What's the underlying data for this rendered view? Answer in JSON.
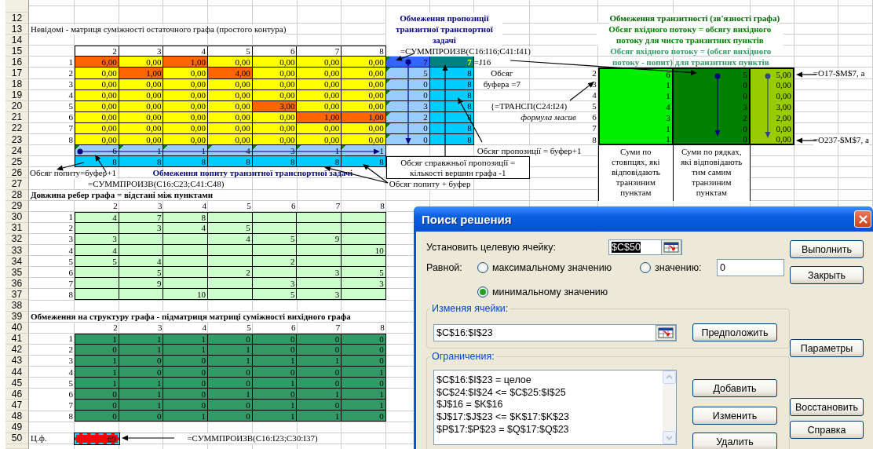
{
  "row_headers": [
    "12",
    "13",
    "14",
    "15",
    "16",
    "17",
    "18",
    "19",
    "20",
    "21",
    "22",
    "23",
    "24",
    "25",
    "26",
    "27",
    "28",
    "29",
    "30",
    "31",
    "32",
    "33",
    "34",
    "35",
    "36",
    "37",
    "38",
    "39",
    "40",
    "41",
    "42",
    "43",
    "44",
    "45",
    "46",
    "47",
    "48",
    "49",
    "50"
  ],
  "unknowns": {
    "title": "Невідомі - матриця суміжності остаточного графа (простого контура)",
    "column_headers": [
      "2",
      "3",
      "4",
      "5",
      "6",
      "7",
      "8"
    ],
    "rows": [
      {
        "label": "1",
        "cells": [
          {
            "value": "6,00",
            "highlighted": true
          },
          {
            "value": "0,00",
            "highlighted": false
          },
          {
            "value": "1,00",
            "highlighted": true
          },
          {
            "value": "0,00",
            "highlighted": false
          },
          {
            "value": "0,00",
            "highlighted": false
          },
          {
            "value": "0,00",
            "highlighted": false
          },
          {
            "value": "0,00",
            "highlighted": false
          }
        ]
      },
      {
        "label": "2",
        "cells": [
          {
            "value": "0,00",
            "highlighted": false
          },
          {
            "value": "1,00",
            "highlighted": true
          },
          {
            "value": "0,00",
            "highlighted": false
          },
          {
            "value": "4,00",
            "highlighted": true
          },
          {
            "value": "0,00",
            "highlighted": false
          },
          {
            "value": "0,00",
            "highlighted": false
          },
          {
            "value": "0,00",
            "highlighted": false
          }
        ]
      },
      {
        "label": "3",
        "cells": [
          {
            "value": "0,00",
            "highlighted": false
          },
          {
            "value": "0,00",
            "highlighted": false
          },
          {
            "value": "0,00",
            "highlighted": false
          },
          {
            "value": "0,00",
            "highlighted": false
          },
          {
            "value": "0,00",
            "highlighted": false
          },
          {
            "value": "0,00",
            "highlighted": false
          },
          {
            "value": "0,00",
            "highlighted": false
          }
        ]
      },
      {
        "label": "4",
        "cells": [
          {
            "value": "0,00",
            "highlighted": false
          },
          {
            "value": "0,00",
            "highlighted": false
          },
          {
            "value": "0,00",
            "highlighted": false
          },
          {
            "value": "0,00",
            "highlighted": false
          },
          {
            "value": "0,00",
            "highlighted": false
          },
          {
            "value": "0,00",
            "highlighted": false
          },
          {
            "value": "0,00",
            "highlighted": false
          }
        ]
      },
      {
        "label": "5",
        "cells": [
          {
            "value": "0,00",
            "highlighted": false
          },
          {
            "value": "0,00",
            "highlighted": false
          },
          {
            "value": "0,00",
            "highlighted": false
          },
          {
            "value": "0,00",
            "highlighted": false
          },
          {
            "value": "3,00",
            "highlighted": true
          },
          {
            "value": "0,00",
            "highlighted": false
          },
          {
            "value": "0,00",
            "highlighted": false
          }
        ]
      },
      {
        "label": "6",
        "cells": [
          {
            "value": "0,00",
            "highlighted": false
          },
          {
            "value": "0,00",
            "highlighted": false
          },
          {
            "value": "0,00",
            "highlighted": false
          },
          {
            "value": "0,00",
            "highlighted": false
          },
          {
            "value": "0,00",
            "highlighted": false
          },
          {
            "value": "1,00",
            "highlighted": true
          },
          {
            "value": "1,00",
            "highlighted": true
          }
        ]
      },
      {
        "label": "7",
        "cells": [
          {
            "value": "0,00",
            "highlighted": false
          },
          {
            "value": "0,00",
            "highlighted": false
          },
          {
            "value": "0,00",
            "highlighted": false
          },
          {
            "value": "0,00",
            "highlighted": false
          },
          {
            "value": "0,00",
            "highlighted": false
          },
          {
            "value": "0,00",
            "highlighted": false
          },
          {
            "value": "0,00",
            "highlighted": false
          }
        ]
      },
      {
        "label": "8",
        "cells": [
          {
            "value": "0,00",
            "highlighted": false
          },
          {
            "value": "0,00",
            "highlighted": false
          },
          {
            "value": "0,00",
            "highlighted": false
          },
          {
            "value": "0,00",
            "highlighted": false
          },
          {
            "value": "0,00",
            "highlighted": false
          },
          {
            "value": "0,00",
            "highlighted": false
          },
          {
            "value": "0,00",
            "highlighted": false
          }
        ]
      }
    ],
    "demand": [
      "6",
      "1",
      "1",
      "4",
      "3",
      "1",
      "1"
    ],
    "demand_limit": [
      "8",
      "8",
      "8",
      "8",
      "8",
      "8",
      "8"
    ]
  },
  "supply": {
    "title": "Обмеження пропозиції транзитної транспортної задачі",
    "formula": "=СУММПРОИЗВ(C16:I16;C41:I41)",
    "rows": [
      {
        "kind": "source",
        "used": "7",
        "limit": "7"
      },
      {
        "kind": "transit",
        "used": "5",
        "limit": "8"
      },
      {
        "kind": "transit",
        "used": "0",
        "limit": "8"
      },
      {
        "kind": "transit",
        "used": "0",
        "limit": "8"
      },
      {
        "kind": "transit",
        "used": "3",
        "limit": "8"
      },
      {
        "kind": "transit",
        "used": "2",
        "limit": "8"
      },
      {
        "kind": "transit",
        "used": "0",
        "limit": "8"
      },
      {
        "kind": "transit",
        "used": "0",
        "limit": "8"
      }
    ],
    "buffer_label": "Обсяг",
    "buffer_value": "буфера =7",
    "transpose_formula": "{=ТРАНСП(C24:I24)",
    "array_note": "формула масив",
    "supply_note": "Обсяг пропозиції = буфер+1",
    "real_supply_note": "Обсяг справжньої пропозиції = кількості вершин графа -1"
  },
  "demand_notes": {
    "demand_note": "Обсяг попиту=буфер+1",
    "title": "Обмеження попиту транзитної транспортної задачі",
    "formula": "=СУММПРОИЗВ(C16:C23;C41:C48)",
    "buffer_note": "Обсяг попиту + буфер"
  },
  "distances": {
    "title": "Довжина ребер графа = відстані між пунктами",
    "column_headers": [
      "2",
      "3",
      "4",
      "5",
      "6",
      "7",
      "8"
    ],
    "rows": [
      {
        "label": "1",
        "cells": [
          "4",
          "7",
          "8",
          null,
          null,
          null,
          null
        ]
      },
      {
        "label": "2",
        "cells": [
          null,
          "3",
          "4",
          "5",
          null,
          null,
          null
        ]
      },
      {
        "label": "3",
        "cells": [
          "3",
          null,
          null,
          "4",
          "5",
          "9",
          null
        ]
      },
      {
        "label": "4",
        "cells": [
          "4",
          null,
          null,
          null,
          null,
          null,
          "10"
        ]
      },
      {
        "label": "5",
        "cells": [
          "5",
          "4",
          null,
          null,
          "2",
          null,
          null
        ]
      },
      {
        "label": "6",
        "cells": [
          null,
          "5",
          null,
          "2",
          null,
          "3",
          "5"
        ]
      },
      {
        "label": "7",
        "cells": [
          null,
          "9",
          null,
          null,
          "3",
          null,
          "3"
        ]
      },
      {
        "label": "8",
        "cells": [
          null,
          null,
          "10",
          null,
          "5",
          "3",
          null
        ]
      }
    ]
  },
  "structure": {
    "title": "Обмеження на структуру графа - підматриця матриці суміжності вихідного графа",
    "column_headers": [
      "2",
      "3",
      "4",
      "5",
      "6",
      "7",
      "8"
    ],
    "rows": [
      {
        "label": "1",
        "cells": [
          "1",
          "1",
          "1",
          "0",
          "0",
          "0",
          "0"
        ]
      },
      {
        "label": "2",
        "cells": [
          "0",
          "1",
          "1",
          "1",
          "0",
          "0",
          "0"
        ]
      },
      {
        "label": "3",
        "cells": [
          "1",
          "0",
          "0",
          "1",
          "1",
          "1",
          "0"
        ]
      },
      {
        "label": "4",
        "cells": [
          "1",
          "0",
          "0",
          "0",
          "0",
          "0",
          "1"
        ]
      },
      {
        "label": "5",
        "cells": [
          "1",
          "1",
          "0",
          "0",
          "1",
          "0",
          "0"
        ]
      },
      {
        "label": "6",
        "cells": [
          "0",
          "1",
          "0",
          "1",
          "0",
          "1",
          "1"
        ]
      },
      {
        "label": "7",
        "cells": [
          "0",
          "1",
          "0",
          "0",
          "1",
          "0",
          "1"
        ]
      },
      {
        "label": "8",
        "cells": [
          "0",
          "0",
          "1",
          "0",
          "1",
          "1",
          "0"
        ]
      }
    ]
  },
  "transit": {
    "title": "Обмеження транзитності (зв'язності графа)",
    "rule_1": "Обсяг вхідного потоку = обсягу вихідного потоку для чисто транзитних пунктів",
    "rule_2": "Обсяг вхідного потоку = (обсяг вихідного потоку - попит) для транзитних пунктів",
    "ref_formula": "=J16",
    "rows": [
      {
        "label": "2",
        "column_sum": "6",
        "row_sum": "5",
        "balance": "5,00"
      },
      {
        "label": "3",
        "column_sum": "1",
        "row_sum": "0",
        "balance": "0,00"
      },
      {
        "label": "4",
        "column_sum": "1",
        "row_sum": "0",
        "balance": "0,00"
      },
      {
        "label": "5",
        "column_sum": "4",
        "row_sum": "3",
        "balance": "3,00"
      },
      {
        "label": "6",
        "column_sum": "3",
        "row_sum": "2",
        "balance": "2,00"
      },
      {
        "label": "7",
        "column_sum": "1",
        "row_sum": "0",
        "balance": "0,00"
      },
      {
        "label": "8",
        "column_sum": "1",
        "row_sum": "0",
        "balance": "0,00"
      }
    ],
    "first_formula": "=O17-$M$7, а",
    "last_formula": "=O237-$M$7, а",
    "column_sum_note": "Суми по стовпцях, які відповідають транзиним пунктам",
    "row_sum_note": "Суми по рядках, які відповідають тим самим транзиним пунктам"
  },
  "objective": {
    "label": "Ц.ф.",
    "value": "69",
    "selected": true,
    "formula": "=СУММПРОИЗВ(C16:I23;C30:I37)"
  },
  "solver_dialog": {
    "title": "Поиск решения",
    "target_label": "Установить целевую ячейку:",
    "target_value": "$C$50",
    "target_selected": true,
    "equal_label": "Равной:",
    "options": [
      {
        "label": "максимальному значению",
        "selected": false
      },
      {
        "label": "значению:",
        "selected": false
      },
      {
        "label": "минимальному значению",
        "selected": true
      }
    ],
    "value": "0",
    "changing_label": "Изменяя ячейки:",
    "changing_value": "$C$16:$I$23",
    "guess_button": "Предположить",
    "constraints_label": "Ограничения:",
    "constraints": [
      "$C$16:$I$23 = целое",
      "$C$24:$I$24 <= $C$25:$I$25",
      "$J$16 = $K$16",
      "$J$17:$J$23 <= $K$17:$K$23",
      "$P$17:$P$23 = $Q$17:$Q$23"
    ],
    "constraint_buttons": [
      "Добавить",
      "Изменить",
      "Удалить"
    ],
    "side_buttons": [
      "Выполнить",
      "Закрыть",
      "Параметры",
      "Восстановить",
      "Справка"
    ]
  }
}
